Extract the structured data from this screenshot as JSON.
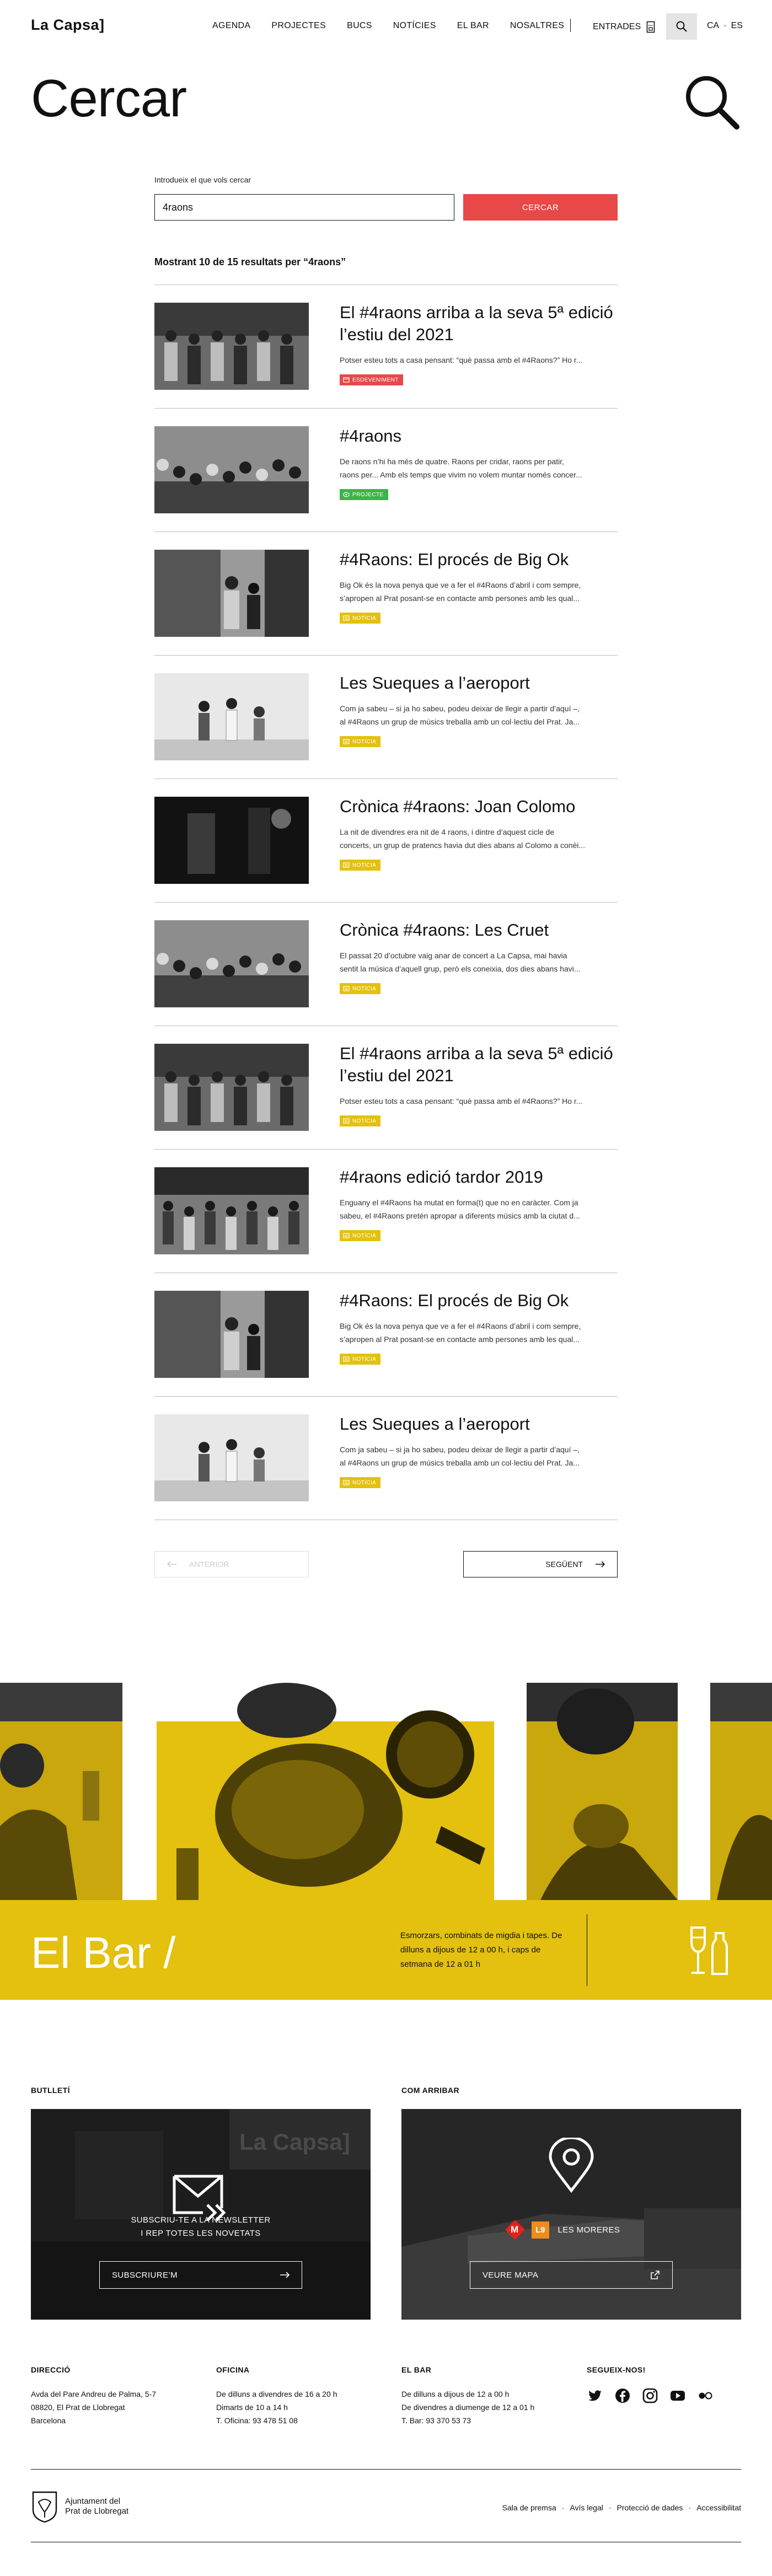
{
  "header": {
    "logo": "La Capsa]",
    "nav": [
      "AGENDA",
      "PROJECTES",
      "BUCS",
      "NOTÍCIES",
      "EL BAR",
      "NOSALTRES"
    ],
    "entrades": "ENTRADES",
    "langs": [
      "CA",
      "ES"
    ]
  },
  "page_title": "Cercar",
  "search": {
    "label": "Introdueix el que vols cercar",
    "value": "4raons",
    "submit": "CERCAR"
  },
  "results_count": "Mostrant 10 de 15 resultats per “4raons”",
  "results": [
    {
      "title": "El #4raons arriba a la seva 5ª edició l’estiu del 2021",
      "excerpt": [
        "Potser esteu tots a casa pensant: “què passa amb el #4Raons?” Ho r..."
      ],
      "badge": "ESDEVENIMENT",
      "badge_color": "#e84848"
    },
    {
      "title": "#4raons",
      "excerpt": [
        "De raons n’hi ha més de quatre. Raons per cridar, raons per patir,",
        "raons per... Amb els temps que vivim no volem muntar només concer..."
      ],
      "badge": "PROJECTE",
      "badge_color": "#3bb54a"
    },
    {
      "title": "#4Raons: El procés de Big Ok",
      "excerpt": [
        "Big Ok és la nova penya que ve a fer el #4Raons d’abril i com sempre,",
        "s’apropen al Prat posant-se en contacte amb persones amb les qual..."
      ],
      "badge": "NOTÍCIA",
      "badge_color": "#e3c10e"
    },
    {
      "title": "Les Sueques a l’aeroport",
      "excerpt": [
        "Com ja sabeu – si ja ho sabeu, podeu deixar de llegir a partir d’aquí –,",
        "al #4Raons un grup de músics treballa amb un col·lectiu del Prat. Ja..."
      ],
      "badge": "NOTÍCIA",
      "badge_color": "#e3c10e"
    },
    {
      "title": "Crònica #4raons: Joan Colomo",
      "excerpt": [
        "La nit de divendres era nit de 4 raons, i dintre d’aquest cicle de",
        "concerts, un grup de pratencs havia dut dies abans al Colomo a conèi..."
      ],
      "badge": "NOTÍCIA",
      "badge_color": "#e3c10e"
    },
    {
      "title": "Crònica #4raons: Les Cruet",
      "excerpt": [
        "El passat 20 d’octubre vaig anar de concert a La Capsa, mai havia",
        "sentit la música d’aquell grup, però els coneixia, dos dies abans havi..."
      ],
      "badge": "NOTÍCIA",
      "badge_color": "#e3c10e"
    },
    {
      "title": "El #4raons arriba a la seva 5ª edició l’estiu del 2021",
      "excerpt": [
        "Potser esteu tots a casa pensant: “què passa amb el #4Raons?” Ho r..."
      ],
      "badge": "NOTÍCIA",
      "badge_color": "#e3c10e"
    },
    {
      "title": "#4raons edició tardor 2019",
      "excerpt": [
        "Enguany el #4Raons ha mutat en forma(t) que no en caràcter. Com ja",
        "sabeu, el #4Raons pretén apropar a diferents músics amb la ciutat d..."
      ],
      "badge": "NOTÍCIA",
      "badge_color": "#e3c10e"
    },
    {
      "title": "#4Raons: El procés de Big Ok",
      "excerpt": [
        "Big Ok és la nova penya que ve a fer el #4Raons d’abril i com sempre,",
        "s’apropen al Prat posant-se en contacte amb persones amb les qual..."
      ],
      "badge": "NOTÍCIA",
      "badge_color": "#e3c10e"
    },
    {
      "title": "Les Sueques a l’aeroport",
      "excerpt": [
        "Com ja sabeu – si ja ho sabeu, podeu deixar de llegir a partir d’aquí –,",
        "al #4Raons un grup de músics treballa amb un col·lectiu del Prat. Ja..."
      ],
      "badge": "NOTÍCIA",
      "badge_color": "#e3c10e"
    }
  ],
  "pagination": {
    "prev": "ANTERIOR",
    "next": "SEGÜENT"
  },
  "bar": {
    "title": "El Bar /",
    "desc": "Esmorzars, combinats de migdia i tapes. De dilluns a dijous de 12 a 00 h, i caps de setmana de 12 a 01 h",
    "yellow": "#e3c10e"
  },
  "newsletter": {
    "heading": "BUTLLETÍ",
    "line1": "SUBSCRIU-TE A LA NEWSLETTER",
    "line2": "I REP TOTES LES NOVETATS",
    "button": "SUBSCRIURE’M",
    "bg_text": "La Capsa]"
  },
  "access": {
    "heading": "COM ARRIBAR",
    "metro": "M",
    "line": "L9",
    "station": "LES MORERES",
    "button": "VEURE MAPA"
  },
  "footer": {
    "direccio": {
      "title": "DIRECCIÓ",
      "lines": [
        "Avda del Pare Andreu de Palma, 5-7",
        "08820, El Prat de Llobregat",
        "Barcelona"
      ]
    },
    "oficina": {
      "title": "OFICINA",
      "lines": [
        "De dilluns a divendres de 16 a 20 h",
        "Dimarts de 10 a 14 h",
        "T. Oficina: 93 478 51 08"
      ]
    },
    "elbar": {
      "title": "EL BAR",
      "lines": [
        "De dilluns a dijous de 12 a 00 h",
        "De divendres a diumenge de 12 a 01 h",
        "T. Bar: 93 370 53 73"
      ]
    },
    "segueix": {
      "title": "SEGUEIX-NOS!"
    },
    "ajuntament": [
      "Ajuntament del",
      "Prat de Llobregat"
    ],
    "legal": [
      "Sala de premsa",
      "Avís legal",
      "Protecció de dades",
      "Accessibilitat"
    ]
  }
}
